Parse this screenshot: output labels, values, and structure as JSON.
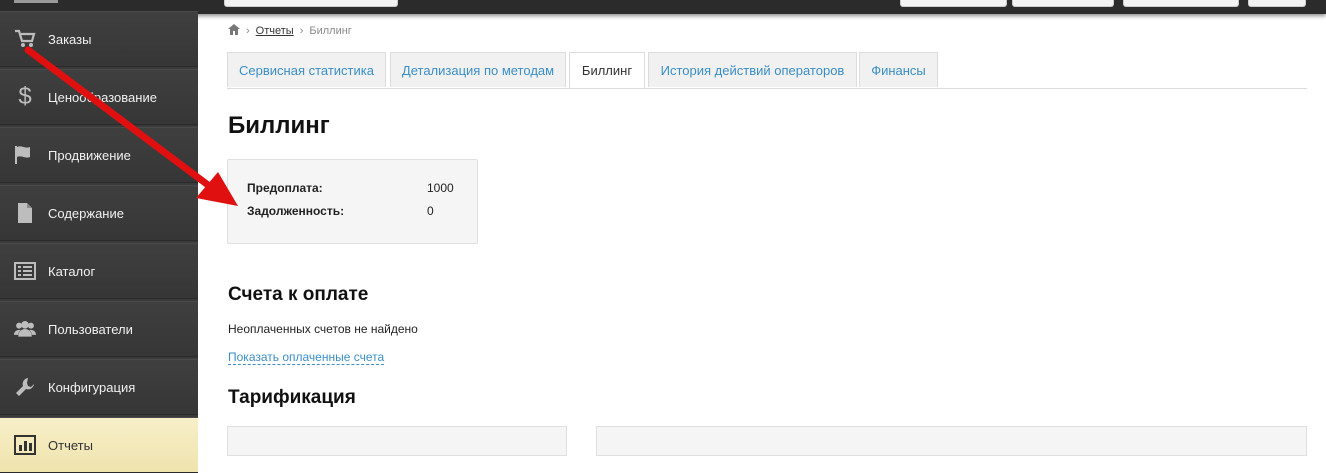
{
  "sidebar": {
    "items": [
      {
        "label": "Заказы",
        "icon": "cart-icon"
      },
      {
        "label": "Ценообразование",
        "icon": "dollar-icon"
      },
      {
        "label": "Продвижение",
        "icon": "flag-icon"
      },
      {
        "label": "Содержание",
        "icon": "document-icon"
      },
      {
        "label": "Каталог",
        "icon": "list-icon"
      },
      {
        "label": "Пользователи",
        "icon": "users-icon"
      },
      {
        "label": "Конфигурация",
        "icon": "wrench-icon"
      },
      {
        "label": "Отчеты",
        "icon": "chart-icon"
      }
    ],
    "active_index": 7
  },
  "breadcrumb": {
    "home_icon": "home-icon",
    "items": [
      "Отчеты",
      "Биллинг"
    ]
  },
  "tabs": [
    {
      "label": "Сервисная статистика"
    },
    {
      "label": "Детализация по методам"
    },
    {
      "label": "Биллинг"
    },
    {
      "label": "История действий операторов"
    },
    {
      "label": "Финансы"
    }
  ],
  "active_tab": "Биллинг",
  "page": {
    "title": "Биллинг",
    "summary": {
      "prepay_label": "Предоплата:",
      "prepay_value": "1000",
      "debt_label": "Задолженность:",
      "debt_value": "0"
    },
    "invoices_title": "Счета к оплате",
    "invoices_empty": "Неоплаченных счетов не найдено",
    "show_paid_link": "Показать оплаченные счета",
    "tariff_title": "Тарификация"
  },
  "colors": {
    "link": "#3a8fc8",
    "annotation_arrow": "#e01010",
    "sidebar_bg": "#3a3a3a",
    "sidebar_active": "#efe3ad"
  }
}
